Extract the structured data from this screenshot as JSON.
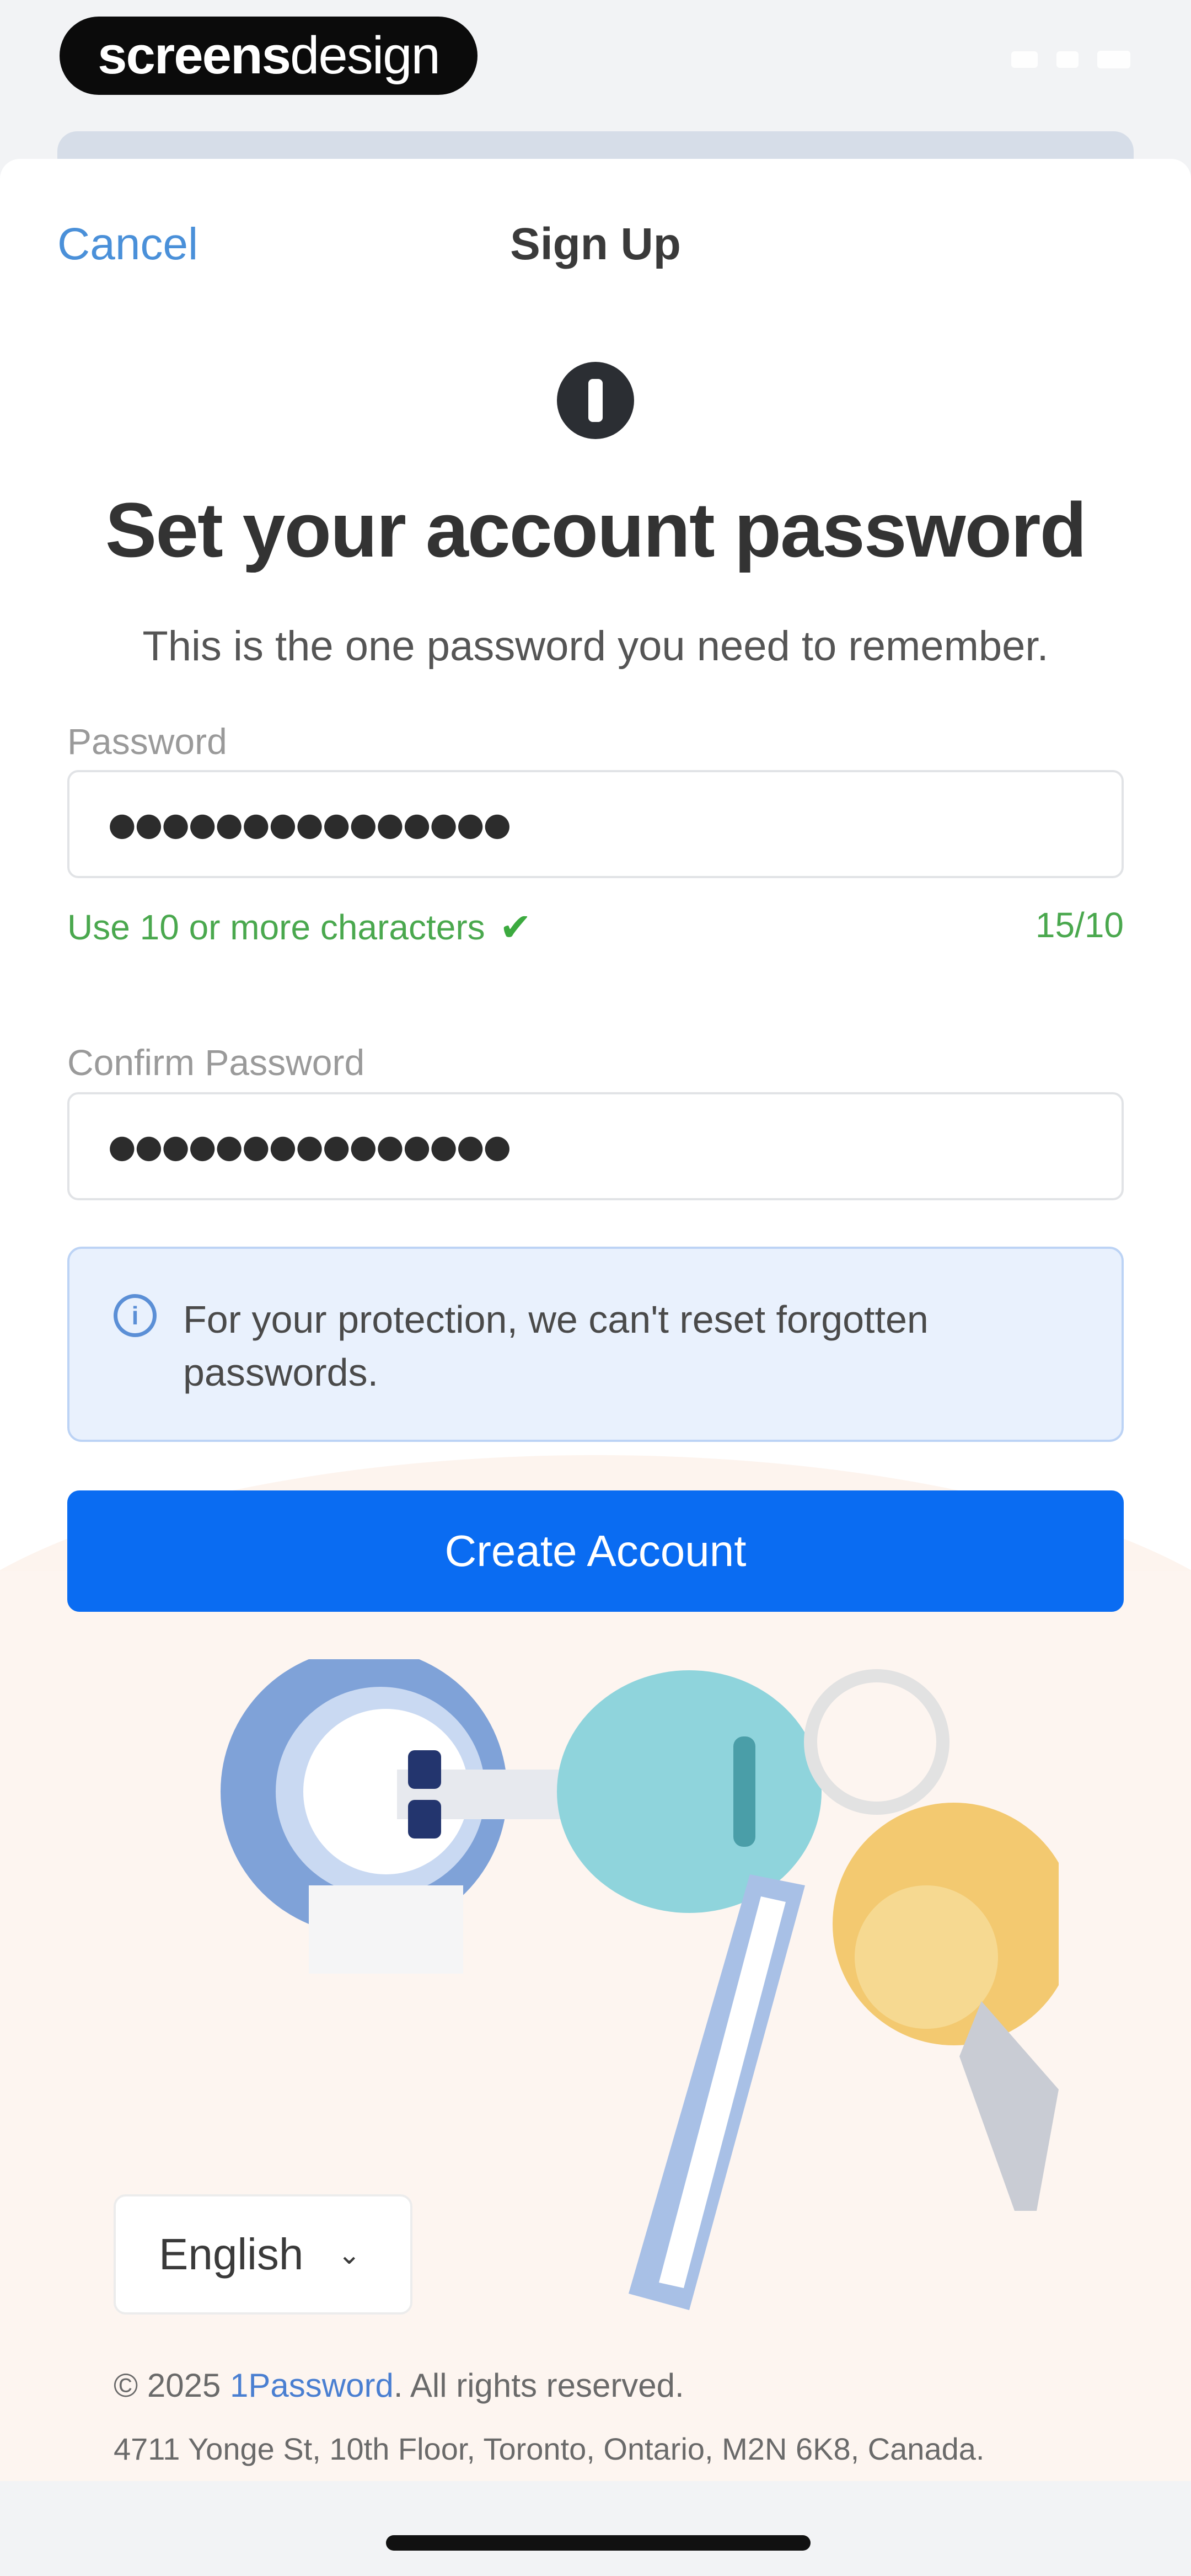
{
  "brand": {
    "part1": "screens",
    "part2": "design"
  },
  "nav": {
    "cancel_label": "Cancel",
    "title": "Sign Up"
  },
  "header": {
    "title": "Set your account password",
    "subtitle": "This is the one password you need to remember."
  },
  "password": {
    "label": "Password",
    "value": "●●●●●●●●●●●●●●●",
    "hint": "Use 10 or more characters",
    "count": "15/10"
  },
  "confirm": {
    "label": "Confirm Password",
    "value": "●●●●●●●●●●●●●●●"
  },
  "notice": {
    "text": "For your protection, we can't reset forgotten passwords."
  },
  "cta": {
    "label": "Create Account"
  },
  "footer": {
    "language": "English",
    "copyright_prefix": "© 2025 ",
    "copyright_brand": "1Password",
    "copyright_suffix": ". All rights reserved.",
    "address": "4711 Yonge St, 10th Floor, Toronto, Ontario, M2N 6K8, Canada."
  },
  "colors": {
    "accent": "#0a6cf2",
    "link": "#4a90d9",
    "success": "#4aa84e",
    "notice_bg": "#e9f1fd"
  },
  "icons": [
    "1password-logo-icon",
    "check-icon",
    "info-icon",
    "chevron-down-icon",
    "keys-illustration"
  ]
}
